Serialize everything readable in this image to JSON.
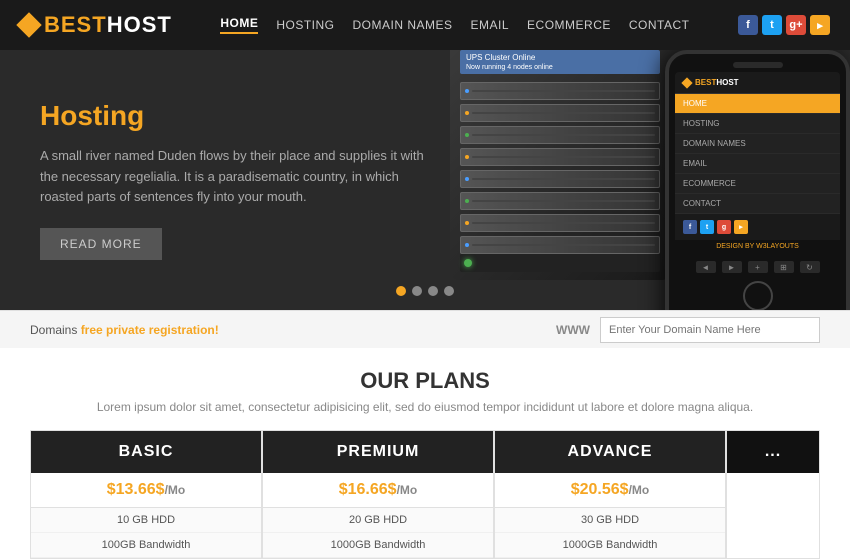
{
  "header": {
    "logo_best": "BEST",
    "logo_host": "HOST",
    "nav": [
      {
        "label": "HOME",
        "active": true
      },
      {
        "label": "HOSTING",
        "active": false
      },
      {
        "label": "DOMAIN NAMES",
        "active": false
      },
      {
        "label": "EMAIL",
        "active": false
      },
      {
        "label": "ECOMMERCE",
        "active": false
      },
      {
        "label": "CONTACT",
        "active": false
      }
    ],
    "social": [
      {
        "name": "facebook",
        "letter": "f",
        "color": "#3b5998"
      },
      {
        "name": "twitter",
        "letter": "t",
        "color": "#1da1f2"
      },
      {
        "name": "google-plus",
        "letter": "g",
        "color": "#dd4b39"
      },
      {
        "name": "rss",
        "letter": "r",
        "color": "#f5a623"
      }
    ]
  },
  "hero": {
    "title": "Hosting",
    "text": "A small river named Duden flows by their place and supplies it with the necessary regelialia. It is a paradisematic country, in which roasted parts of sentences fly into your mouth.",
    "read_more": "READ MORE",
    "dots": [
      true,
      false,
      false,
      false
    ]
  },
  "mobile": {
    "logo_best": "BEST",
    "logo_host": "HOST",
    "nav_items": [
      "HOME",
      "HOSTING",
      "DOMAIN NAMES",
      "EMAIL",
      "ECOMMERCE",
      "CONTACT"
    ],
    "design_by": "DESIGN BY ",
    "design_link": "W3LAYOUTS"
  },
  "domain_bar": {
    "text": "Domains ",
    "highlight": "free",
    "text2": " private registration!",
    "www_label": "WWW",
    "input_placeholder": "Enter Your Domain Name Here"
  },
  "plans": {
    "title": "OUR PLANS",
    "subtitle": "Lorem ipsum dolor sit amet, consectetur adipisicing elit, sed do eiusmod tempor incididunt ut labore et dolore magna aliqua.",
    "cards": [
      {
        "name": "BASIC",
        "price": "$13.66$",
        "price_suffix": "/Mo",
        "feature1": "10 GB HDD",
        "feature2": "100GB Bandwidth"
      },
      {
        "name": "PREMIUM",
        "price": "$16.66$",
        "price_suffix": "/Mo",
        "feature1": "20 GB HDD",
        "feature2": "1000GB Bandwidth"
      },
      {
        "name": "ADVANCE",
        "price": "$20.56$",
        "price_suffix": "/Mo",
        "feature1": "30 GB HDD",
        "feature2": "1000GB Bandwidth"
      }
    ]
  }
}
